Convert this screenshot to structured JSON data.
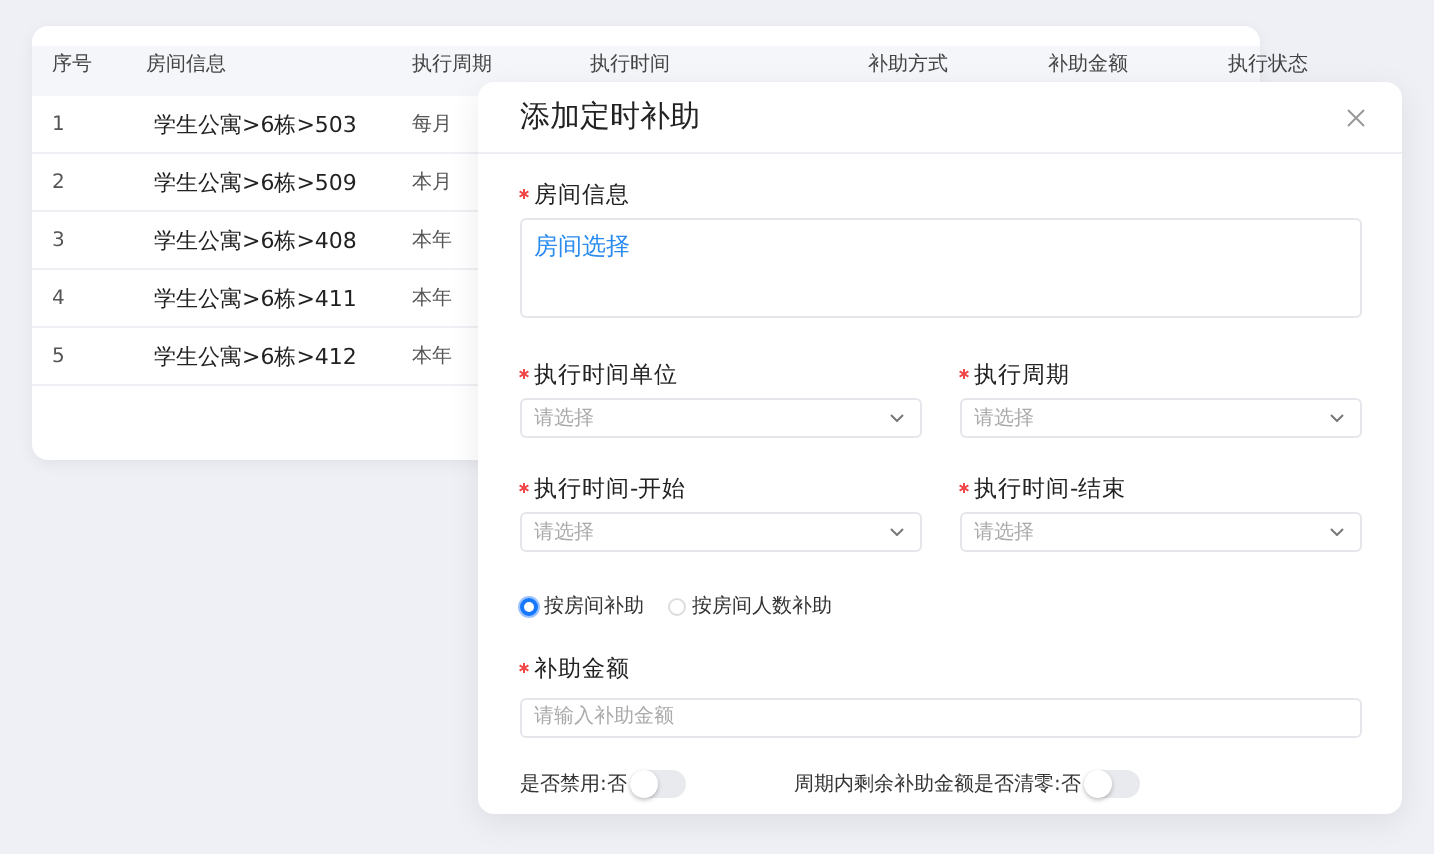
{
  "table": {
    "columns": [
      "序号",
      "房间信息",
      "执行周期",
      "执行时间",
      "补助方式",
      "补助金额",
      "执行状态"
    ],
    "rows": [
      {
        "index": "1",
        "room": "学生公寓>6栋>503",
        "period": "每月"
      },
      {
        "index": "2",
        "room": "学生公寓>6栋>509",
        "period": "本月"
      },
      {
        "index": "3",
        "room": "学生公寓>6栋>408",
        "period": "本年"
      },
      {
        "index": "4",
        "room": "学生公寓>6栋>411",
        "period": "本年"
      },
      {
        "index": "5",
        "room": "学生公寓>6栋>412",
        "period": "本年"
      }
    ]
  },
  "dialog": {
    "title": "添加定时补助",
    "room_info": {
      "label": "房间信息",
      "required": true,
      "link": "房间选择"
    },
    "selects": [
      {
        "label": "执行时间单位",
        "required": true,
        "placeholder": "请选择"
      },
      {
        "label": "执行周期",
        "required": true,
        "placeholder": "请选择"
      },
      {
        "label": "执行时间-开始",
        "required": true,
        "placeholder": "请选择"
      },
      {
        "label": "执行时间-结束",
        "required": true,
        "placeholder": "请选择"
      }
    ],
    "radios": [
      {
        "label": "按房间补助",
        "selected": true
      },
      {
        "label": "按房间人数补助",
        "selected": false
      }
    ],
    "amount": {
      "label": "补助金额",
      "required": true,
      "placeholder": "请输入补助金额"
    },
    "switches": [
      {
        "label": "是否禁用:否",
        "on": false
      },
      {
        "label": "周期内剩余补助金额是否清零:否",
        "on": false
      }
    ]
  }
}
